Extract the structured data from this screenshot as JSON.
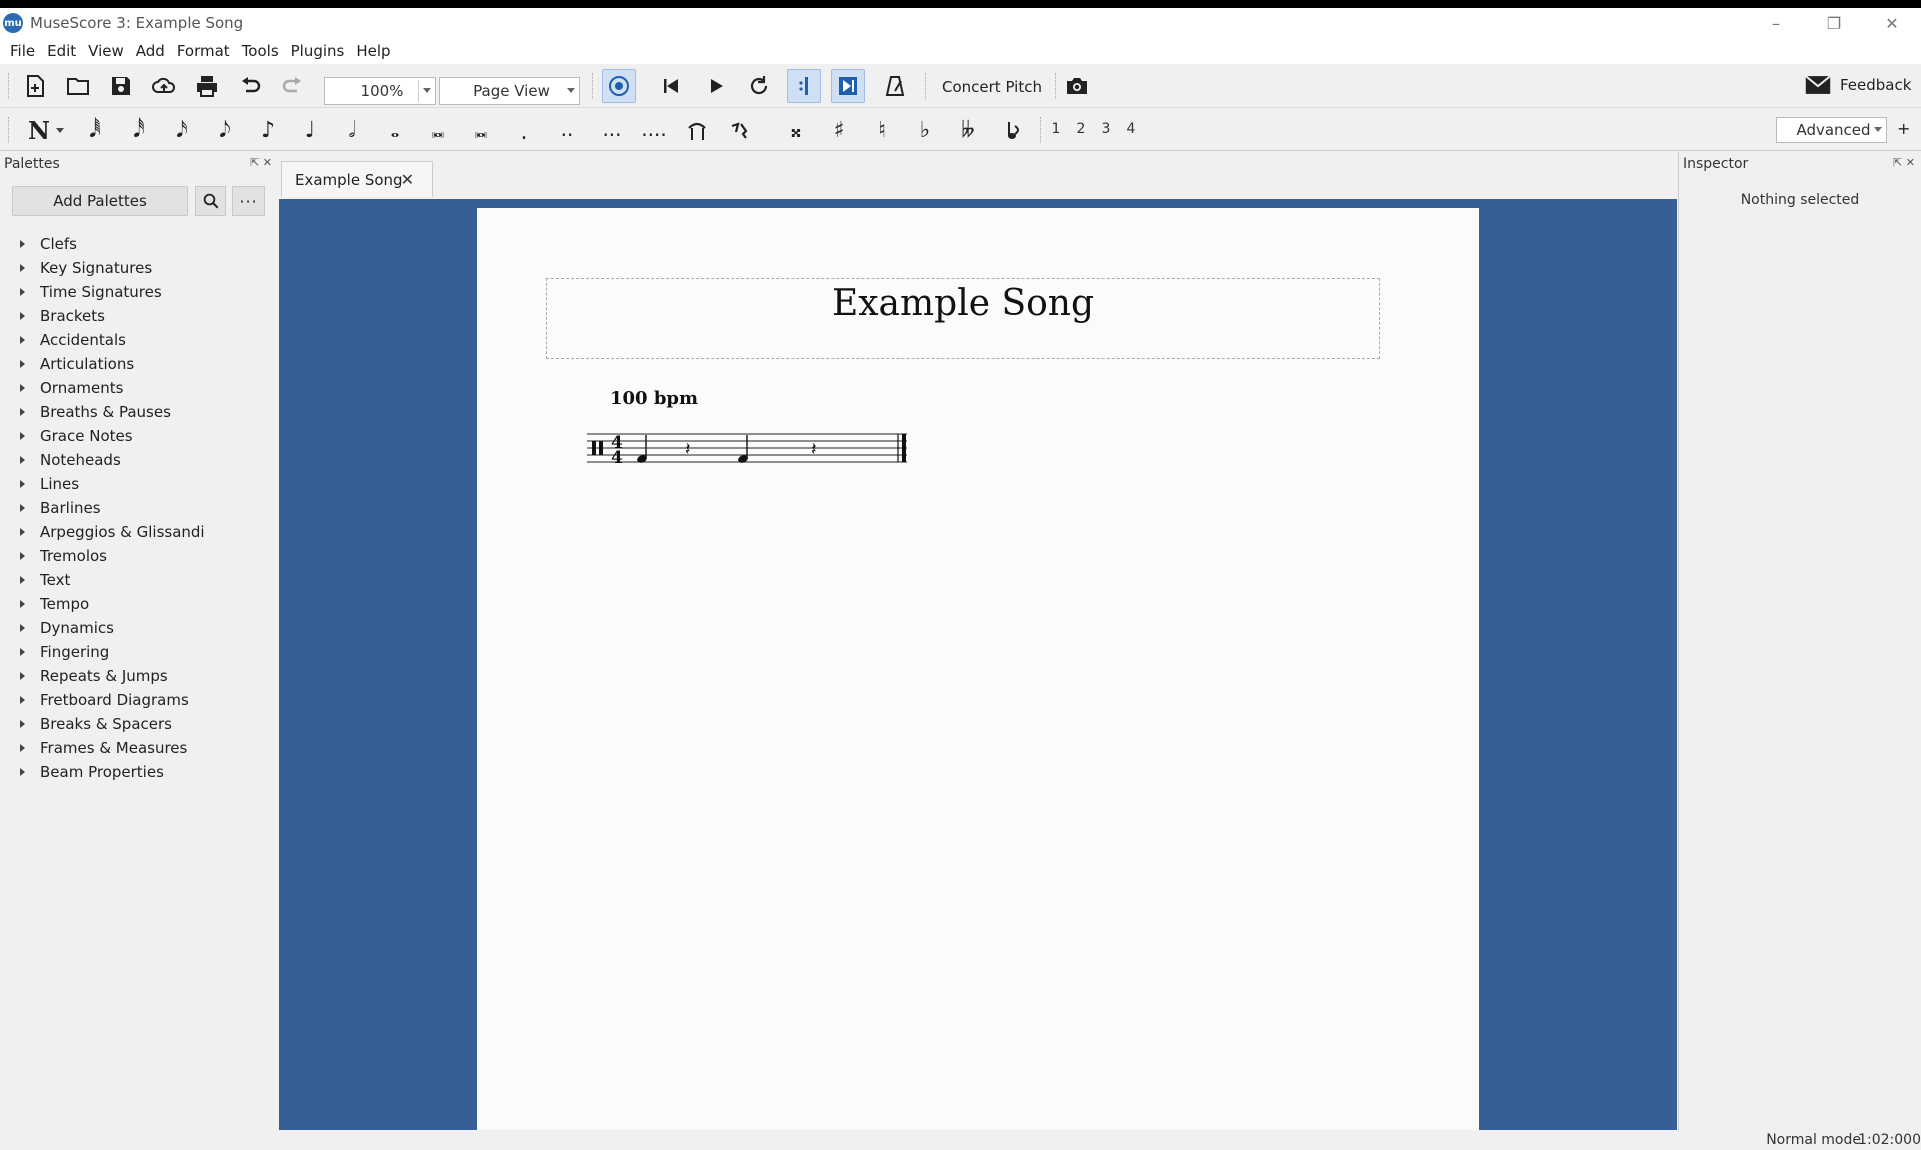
{
  "window": {
    "title": "MuseScore 3: Example Song",
    "app_icon_text": "mu"
  },
  "menu": [
    "File",
    "Edit",
    "View",
    "Add",
    "Format",
    "Tools",
    "Plugins",
    "Help"
  ],
  "toolbar": {
    "zoom_value": "100%",
    "view_mode": "Page View",
    "concert_pitch_label": "Concert Pitch",
    "feedback_label": "Feedback",
    "workspace": "Advanced",
    "workspace_add": "+"
  },
  "note_input": {
    "mode_label": "N",
    "durations": [
      "𝅘𝅥𝅱",
      "𝅘𝅥𝅰",
      "𝅘𝅥𝅯",
      "𝅘𝅥𝅮",
      "♪",
      "♩",
      "𝅗𝅥",
      "𝅝",
      "𝅜",
      "𝅜",
      "."
    ],
    "accidentals": [
      "𝄪",
      "♯",
      "♮",
      "♭",
      "𝄫"
    ],
    "voices": [
      "1",
      "2",
      "3",
      "4"
    ]
  },
  "palettes": {
    "title": "Palettes",
    "add_button": "Add Palettes",
    "more_button": "···",
    "items": [
      "Clefs",
      "Key Signatures",
      "Time Signatures",
      "Brackets",
      "Accidentals",
      "Articulations",
      "Ornaments",
      "Breaths & Pauses",
      "Grace Notes",
      "Noteheads",
      "Lines",
      "Barlines",
      "Arpeggios & Glissandi",
      "Tremolos",
      "Text",
      "Tempo",
      "Dynamics",
      "Fingering",
      "Repeats & Jumps",
      "Fretboard Diagrams",
      "Breaks & Spacers",
      "Frames & Measures",
      "Beam Properties"
    ]
  },
  "score": {
    "tab_label": "Example Song",
    "tab_close": "✕",
    "title": "Example Song",
    "tempo_text": "100 bpm",
    "time_signature": [
      "4",
      "4"
    ]
  },
  "inspector": {
    "title": "Inspector",
    "empty_text": "Nothing selected"
  },
  "status": {
    "mode": "Normal mode",
    "position": "1:02:000"
  }
}
